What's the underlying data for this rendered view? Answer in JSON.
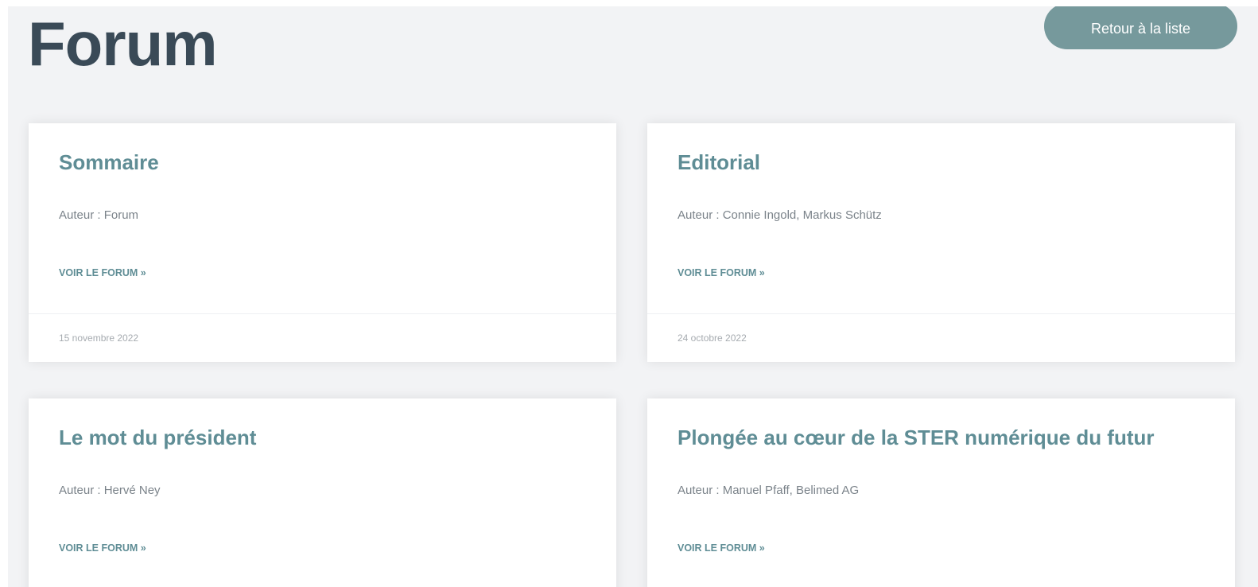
{
  "page": {
    "title": "Forum",
    "back_button_label": "Retour à la liste"
  },
  "articles": [
    {
      "title": "Sommaire",
      "author": "Auteur : Forum",
      "link_label": "VOIR LE FORUM »",
      "date": "15 novembre 2022"
    },
    {
      "title": "Editorial",
      "author": "Auteur : Connie Ingold, Markus Schütz",
      "link_label": "VOIR LE FORUM »",
      "date": "24 octobre 2022"
    },
    {
      "title": "Le mot du président",
      "author": "Auteur : Hervé Ney",
      "link_label": "VOIR LE FORUM »"
    },
    {
      "title": "Plongée au cœur de la STER numérique du futur",
      "author": "Auteur : Manuel Pfaff, Belimed AG",
      "link_label": "VOIR LE FORUM »"
    }
  ],
  "colors": {
    "page_background": "#f2f3f5",
    "heading": "#3a4a57",
    "accent": "#5f8d95",
    "button": "#76999c"
  }
}
